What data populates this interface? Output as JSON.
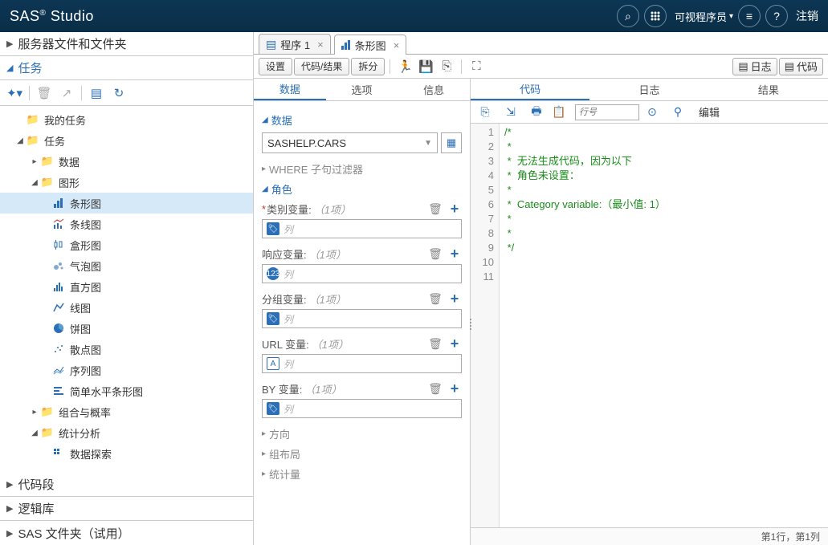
{
  "header": {
    "brand_html": "SAS® Studio",
    "user_menu": "可视程序员",
    "logout": "注销"
  },
  "sidebar": {
    "sections": {
      "files": "服务器文件和文件夹",
      "tasks": "任务",
      "snippets": "代码段",
      "libs": "逻辑库",
      "sasfolders": "SAS 文件夹（试用）"
    },
    "tree": {
      "my_tasks": "我的任务",
      "tasks": "任务",
      "data": "数据",
      "graphics": "图形",
      "bar": "条形图",
      "line": "条线图",
      "box": "盒形图",
      "bubble": "气泡图",
      "hist": "直方图",
      "lineplot": "线图",
      "pie": "饼图",
      "scatter": "散点图",
      "series": "序列图",
      "simplebar": "简单水平条形图",
      "combo": "组合与概率",
      "stats": "统计分析",
      "explore": "数据探索"
    }
  },
  "tabs": {
    "prog1": "程序 1",
    "bar": "条形图"
  },
  "subtoolbar": {
    "settings": "设置",
    "coderesult": "代码/结果",
    "split": "拆分",
    "log": "日志",
    "code": "代码"
  },
  "leftpane": {
    "tabs": {
      "data": "数据",
      "options": "选项",
      "info": "信息"
    },
    "sect_data": "数据",
    "dataset": "SASHELP.CARS",
    "sect_where": "WHERE 子句过滤器",
    "sect_roles": "角色",
    "roles": {
      "category": {
        "label": "类别变量:",
        "hint": "（1项）",
        "ph": "列",
        "required": true,
        "icon": "tag"
      },
      "response": {
        "label": "响应变量:",
        "hint": "（1项）",
        "ph": "列",
        "icon": "num"
      },
      "group": {
        "label": "分组变量:",
        "hint": "（1项）",
        "ph": "列",
        "icon": "tag"
      },
      "url": {
        "label": "URL 变量:",
        "hint": "（1项）",
        "ph": "列",
        "icon": "a"
      },
      "by": {
        "label": "BY 变量:",
        "hint": "（1项）",
        "ph": "列",
        "icon": "tag"
      }
    },
    "sect_dir": "方向",
    "sect_layout": "组布局",
    "sect_stat": "统计量"
  },
  "rightpane": {
    "tabs": {
      "code": "代码",
      "log": "日志",
      "results": "结果"
    },
    "lineno_ph": "行号",
    "edit": "编辑",
    "code_lines": [
      "/*",
      " *",
      " *  无法生成代码，因为以下",
      " *  角色未设置：",
      " *",
      " *  Category variable:（最小值: 1）",
      " *",
      " *",
      " */",
      "",
      ""
    ],
    "status": "第1行，第1列"
  }
}
